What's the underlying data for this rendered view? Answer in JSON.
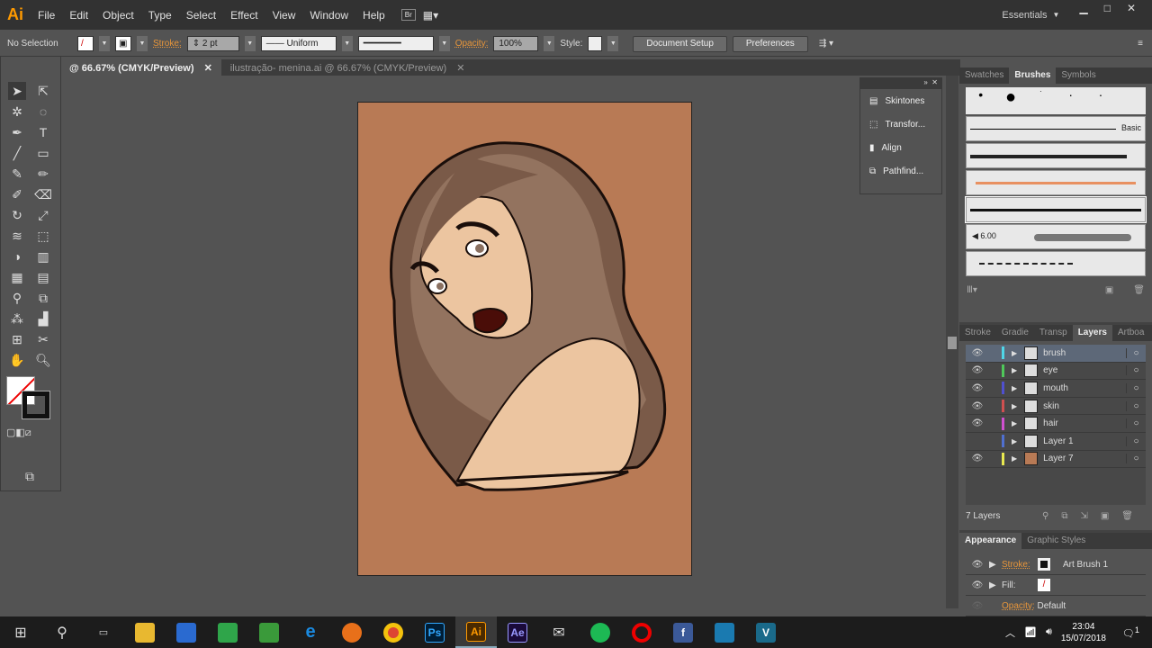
{
  "app": {
    "logo": "Ai",
    "workspace": "Essentials"
  },
  "menu": [
    "File",
    "Edit",
    "Object",
    "Type",
    "Select",
    "Effect",
    "View",
    "Window",
    "Help"
  ],
  "control": {
    "selection": "No Selection",
    "stroke_label": "Stroke:",
    "stroke_value": "2 pt",
    "profile": "Uniform",
    "opacity_label": "Opacity:",
    "opacity_value": "100%",
    "style_label": "Style:",
    "document_setup": "Document Setup",
    "preferences": "Preferences"
  },
  "tabs": [
    {
      "label": "@ 66.67% (CMYK/Preview)",
      "active": true
    },
    {
      "label": "ilustração- menina.ai @ 66.67% (CMYK/Preview)",
      "active": false
    }
  ],
  "float_panel": [
    "Skintones",
    "Transfor...",
    "Align",
    "Pathfind..."
  ],
  "brushes_panel": {
    "tabs": [
      "Swatches",
      "Brushes",
      "Symbols"
    ],
    "active": "Brushes",
    "basic_label": "Basic",
    "size_label": "6.00"
  },
  "layers_panel": {
    "tabs": [
      "Stroke",
      "Gradie",
      "Transp",
      "Layers",
      "Artboa"
    ],
    "active": "Layers",
    "count": "7 Layers",
    "layers": [
      {
        "name": "brush",
        "color": "#4fd6e8",
        "visible": true,
        "selected": true
      },
      {
        "name": "eye",
        "color": "#4fc85a",
        "visible": true
      },
      {
        "name": "mouth",
        "color": "#5050d0",
        "visible": true
      },
      {
        "name": "skin",
        "color": "#d05050",
        "visible": true
      },
      {
        "name": "hair",
        "color": "#d050d0",
        "visible": true
      },
      {
        "name": "Layer 1",
        "color": "#5070d0",
        "visible": false
      },
      {
        "name": "Layer 7",
        "color": "#e8e850",
        "visible": true
      }
    ]
  },
  "appearance": {
    "tabs": [
      "Appearance",
      "Graphic Styles"
    ],
    "stroke_label": "Stroke:",
    "stroke_value": "Art Brush 1",
    "fill_label": "Fill:",
    "opacity_label": "Opacity:",
    "opacity_value": "Default"
  },
  "taskbar": {
    "time": "23:04",
    "date": "15/07/2018",
    "notifications": "1",
    "apps": [
      {
        "label": "Ps",
        "color": "#001e36"
      },
      {
        "label": "Ai",
        "color": "#4a2a00"
      },
      {
        "label": "Ae",
        "color": "#1a0a3a"
      }
    ]
  }
}
